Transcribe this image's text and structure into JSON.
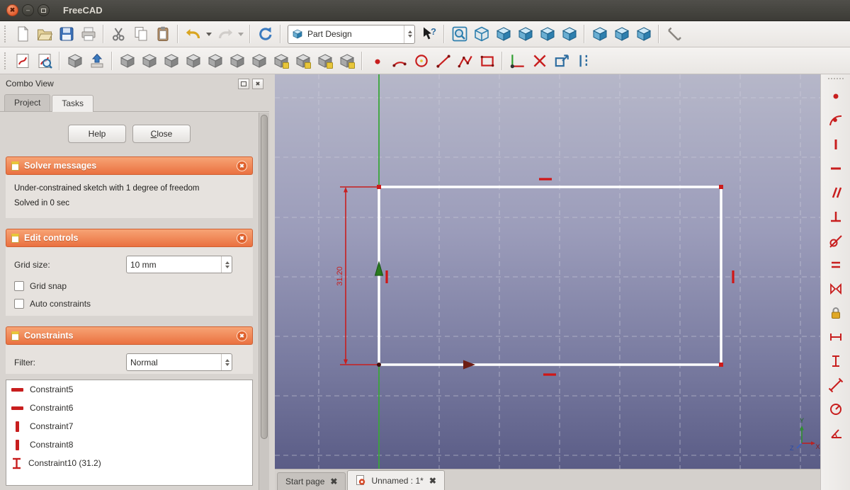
{
  "window": {
    "title": "FreeCAD"
  },
  "toolbars": {
    "row1": {
      "icons": [
        "new-document",
        "open-document",
        "save-document",
        "print",
        "cut",
        "copy",
        "paste",
        "undo",
        "redo",
        "refresh",
        "whats-this",
        "fit-all",
        "view-axonometric",
        "view-front",
        "view-top",
        "view-right",
        "view-rear",
        "view-bottom",
        "view-left",
        "view-isometric",
        "measure-distance"
      ],
      "workbench_selector": {
        "value": "Part Design",
        "icon": "part-design-workbench-icon"
      }
    },
    "row2": {
      "icons": [
        "create-sketch",
        "edit-sketch",
        "create-body",
        "map-sketch",
        "pad",
        "revolution",
        "pocket",
        "hole",
        "groove",
        "additive-loft",
        "additive-pipe",
        "fillet",
        "chamfer",
        "draft",
        "thickness",
        "create-point",
        "create-arc",
        "create-circle",
        "create-line",
        "create-polyline",
        "create-rectangle",
        "external-geometry",
        "trim-edge",
        "carbon-copy",
        "toggle-construction"
      ]
    },
    "right": {
      "icons": [
        "constrain-coincident",
        "constrain-point-on-object",
        "constrain-vertical",
        "constrain-horizontal",
        "constrain-parallel",
        "constrain-perpendicular",
        "constrain-tangent",
        "constrain-equal",
        "constrain-symmetric",
        "constrain-lock",
        "constrain-distance-x",
        "constrain-distance-y",
        "constrain-distance",
        "constrain-radius",
        "constrain-angle"
      ]
    }
  },
  "combo_view": {
    "title": "Combo View",
    "tabs": [
      {
        "label": "Project",
        "active": false
      },
      {
        "label": "Tasks",
        "active": true
      }
    ],
    "buttons": {
      "help": "Help",
      "close": "Close"
    },
    "solver": {
      "title": "Solver messages",
      "line1": "Under-constrained sketch with 1 degree of freedom",
      "line2": "Solved in 0 sec"
    },
    "edit_controls": {
      "title": "Edit controls",
      "grid_size_label": "Grid size:",
      "grid_size_value": "10 mm",
      "grid_snap": "Grid snap",
      "auto_constraints": "Auto constraints"
    },
    "constraints": {
      "title": "Constraints",
      "filter_label": "Filter:",
      "filter_value": "Normal",
      "items": [
        {
          "icon": "horizontal-constraint-icon",
          "label": "Constraint5"
        },
        {
          "icon": "horizontal-constraint-icon",
          "label": "Constraint6"
        },
        {
          "icon": "vertical-constraint-icon",
          "label": "Constraint7"
        },
        {
          "icon": "vertical-constraint-icon",
          "label": "Constraint8"
        },
        {
          "icon": "vertical-distance-icon",
          "label": "Constraint10 (31.2)"
        }
      ]
    }
  },
  "viewport": {
    "dimension_label": "31.20",
    "axis_indicator": {
      "x": "X",
      "y": "Y",
      "z": "Z"
    },
    "colors": {
      "bg_top": "#B6B7C9",
      "bg_bottom": "#5A5C86",
      "sketch_line": "#FFFFFF",
      "constraint_red": "#C81E1E",
      "axis_green": "#3AA63A"
    }
  },
  "document_tabs": [
    {
      "label": "Start page",
      "active": false
    },
    {
      "label": "Unnamed : 1*",
      "active": true
    }
  ],
  "theme": {
    "accent_orange": "#EA7140",
    "titlebar_bg": "#3C3B36",
    "panel_bg": "#D8D4D0"
  }
}
